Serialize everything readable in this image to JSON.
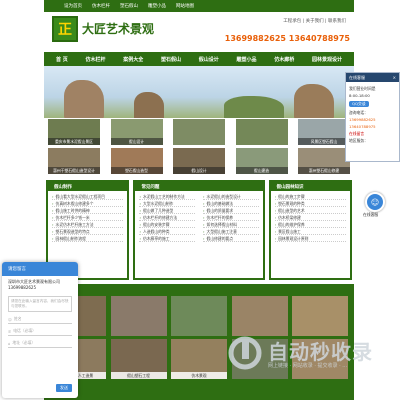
{
  "topbar": {
    "links": [
      "设为首页",
      "仿木栏杆",
      "塑石假山",
      "雕塑小品",
      "网站地图"
    ]
  },
  "header": {
    "logo_char": "正",
    "site_name": "大匠艺术景观",
    "contact_links": "工程承包 | 关于我们 | 联系我们",
    "phone": "13699882625 13640788975"
  },
  "nav": {
    "items": [
      "首 页",
      "仿木栏杆",
      "案例大全",
      "塑石假山",
      "假山设计",
      "雕塑小品",
      "仿木廊桥",
      "园林景观设计"
    ]
  },
  "thumbs_row1": [
    "重庆市景水泥假山景区",
    "假山设计",
    "",
    "",
    "风景区塑石假山",
    "小区仿木栏杆"
  ],
  "thumbs_row2": [
    "惠州干塑石假山造型设计",
    "塑石假山造型",
    "假山设计",
    "假山建造",
    "惠州塑石假山修建",
    "惠州仿木栏杆"
  ],
  "panels": [
    {
      "title": "假山制作",
      "items": [
        "假山看大型水泥假山工程项目",
        "仿真树木假山修建多个",
        "假山施工时供的精神",
        "仿木栏杆多少钱一米",
        "水泥仿木栏杆施工方法",
        "塑石景观造型的特点",
        "园林假山制作流程"
      ]
    },
    {
      "title": "常见问题",
      "items": [
        "水泥假山工艺的制作方法",
        "大型水泥假山制作",
        "假山做了几种造型",
        "仿木栏杆的修建方法",
        "假山的安装步骤",
        "人造假山的种类",
        "仿木廊亭的施工"
      ]
    },
    {
      "title": "假山园林知识",
      "items": [
        "假山的施工步骤",
        "塑石景观的种类",
        "假山造型的艺术",
        "仿木桥梁修建",
        "假山的维护保养",
        "景区假山施工",
        "园林景观设计原则"
      ]
    }
  ],
  "panel_center_right": [
    "水泥假山的造型设计",
    "假山的基础做法",
    "假山的质量要求",
    "仿木栏杆的保养",
    "如何选择假山材料",
    "大型假山施工注意",
    "假山修建的要点"
  ],
  "gallery": {
    "row1": [
      "",
      "",
      "",
      "",
      ""
    ],
    "row2": [
      "水泥假山人工造景",
      "假山塑石工程",
      "仿木景观",
      "",
      ""
    ]
  },
  "sidebar": {
    "head": "在线客服",
    "line1": "我们营业时间是",
    "line2": "8:00-18:00",
    "qq": "QQ交谈",
    "phone_label": "咨询电话：",
    "phone1": "13699882625",
    "phone2": "13640788975",
    "service": "在线留言",
    "more": "在线客服",
    "more2": "地区服务：",
    "more3": "全国承接工程"
  },
  "chat": {
    "label": "在线客服"
  },
  "message_box": {
    "title": "请您留言",
    "company": "深圳市大匠艺术景观有限公司13699882625",
    "content_placeholder": "请您在此输入留言内容，我们会尽快与您联系。",
    "name_placeholder": "姓名",
    "phone_placeholder": "电话（必填）",
    "address_placeholder": "地址（必填）",
    "send": "发送"
  },
  "watermark": {
    "text": "自动秒收录",
    "sub": "网上链接 · 网站收录 · 提交收录 · ..."
  },
  "colors": {
    "brand": "#2e6e12",
    "accent": "#e9600a",
    "chat": "#3a86d8"
  }
}
